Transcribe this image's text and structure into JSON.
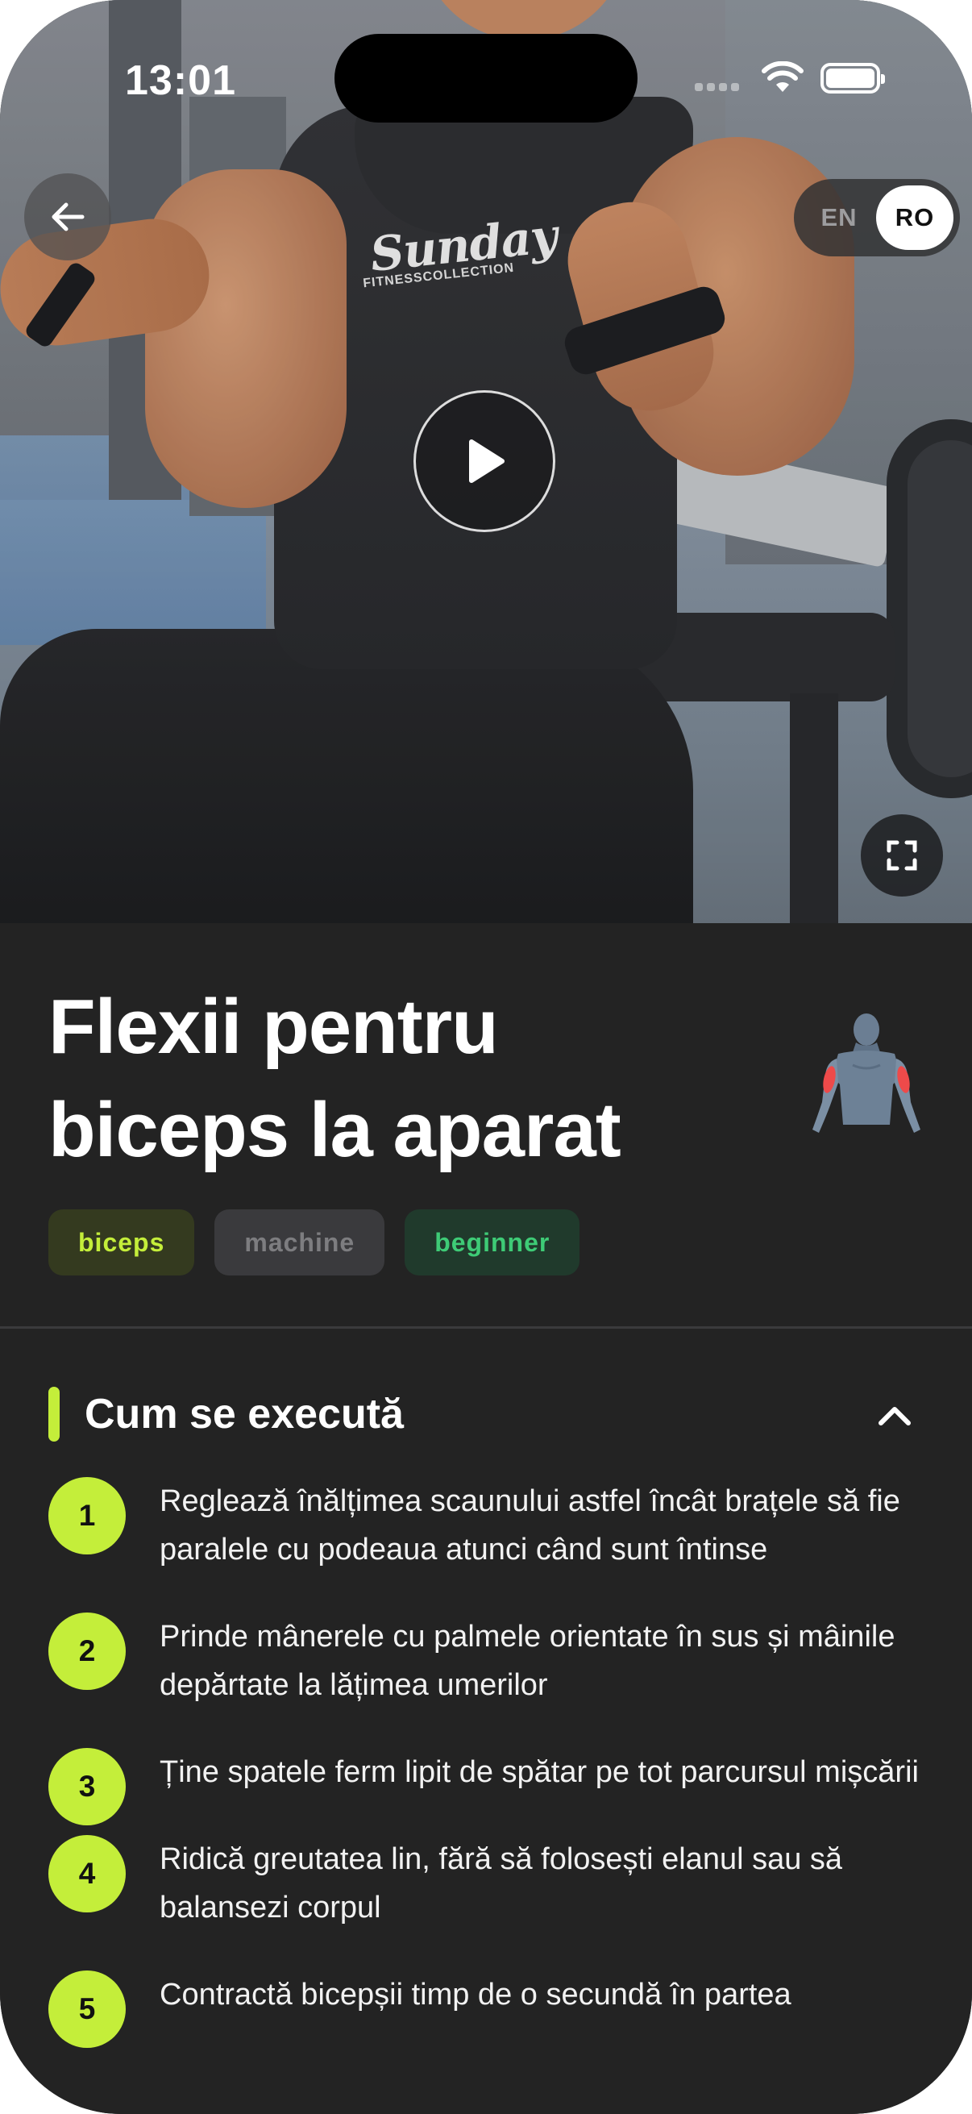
{
  "status_bar": {
    "time": "13:01"
  },
  "language": {
    "options": [
      "EN",
      "RO"
    ],
    "selected": "RO"
  },
  "video": {
    "shirt_logo": "Sunday",
    "shirt_logo_sub": "FITNESSCOLLECTION"
  },
  "exercise": {
    "title": "Flexii pentru biceps la aparat",
    "tags": [
      "biceps",
      "machine",
      "beginner"
    ]
  },
  "section": {
    "title": "Cum se execută",
    "expanded": true
  },
  "steps": [
    {
      "number": "1",
      "text": "Reglează înălțimea scaunului astfel încât brațele să fie paralele cu podeaua atunci când sunt întinse"
    },
    {
      "number": "2",
      "text": "Prinde mânerele cu palmele orientate în sus și mâinile depărtate la lățimea umerilor"
    },
    {
      "number": "3",
      "text": "Ține spatele ferm lipit de spătar pe tot parcursul mișcării"
    },
    {
      "number": "4",
      "text": "Ridică greutatea lin, fără să folosești elanul sau să balansezi corpul"
    },
    {
      "number": "5",
      "text": "Contractă bicepșii timp de o secundă în partea"
    }
  ],
  "colors": {
    "accent": "#c4ee3a",
    "background": "#232323",
    "beginner": "#3ecb76"
  },
  "icons": [
    "back-arrow-icon",
    "play-icon",
    "fullscreen-icon",
    "chevron-up-icon",
    "muscle-biceps-icon",
    "wifi-icon",
    "battery-icon"
  ]
}
